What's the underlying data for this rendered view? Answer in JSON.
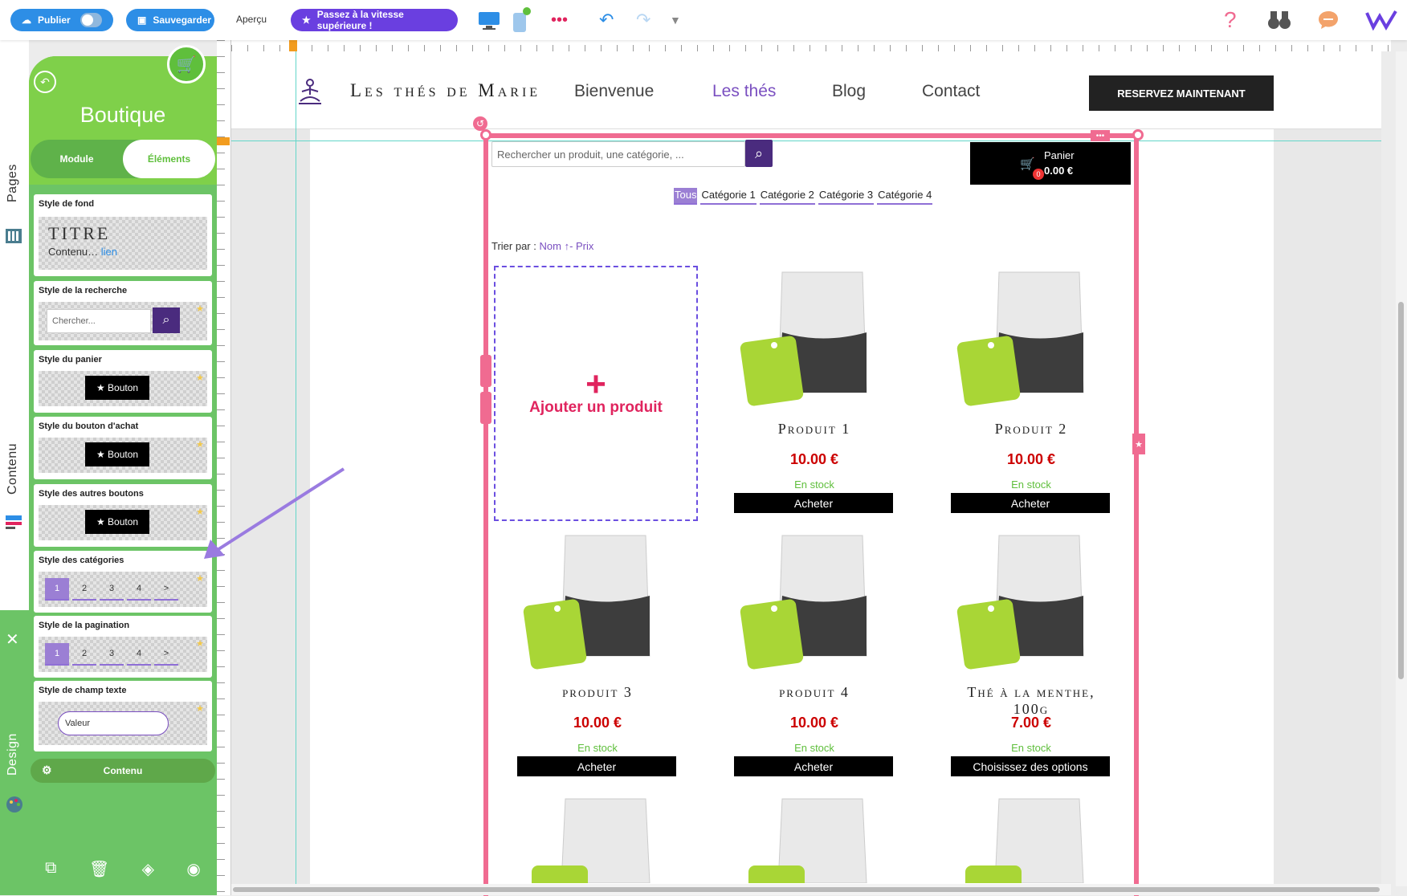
{
  "toolbar": {
    "publish_label": "Publier",
    "save_label": "Sauvegarder",
    "preview_label": "Aperçu",
    "upgrade_label": "Passez à la vitesse supérieure !",
    "help_icon": "?"
  },
  "rail": {
    "pages_label": "Pages",
    "content_label": "Contenu",
    "design_label": "Design"
  },
  "panel": {
    "title": "Boutique",
    "tabs": [
      "Module",
      "Éléments"
    ],
    "cards": [
      {
        "title": "Style de fond",
        "sample_title": "TITRE",
        "sample_text": "Contenu…",
        "sample_link": "lien"
      },
      {
        "title": "Style de la recherche",
        "placeholder": "Chercher..."
      },
      {
        "title": "Style du panier",
        "button": "★ Bouton"
      },
      {
        "title": "Style du bouton d'achat",
        "button": "★ Bouton"
      },
      {
        "title": "Style des autres boutons",
        "button": "★ Bouton"
      },
      {
        "title": "Style des catégories",
        "pages": [
          "1",
          "2",
          "3",
          "4",
          ">"
        ]
      },
      {
        "title": "Style de la pagination",
        "pages": [
          "1",
          "2",
          "3",
          "4",
          ">"
        ]
      },
      {
        "title": "Style de champ texte",
        "value": "Valeur"
      }
    ],
    "footer_label": "Contenu"
  },
  "site": {
    "name": "Les thés de Marie",
    "nav": [
      "Bienvenue",
      "Les thés",
      "Blog",
      "Contact"
    ],
    "active_nav": "Les thés",
    "cta": "RESERVEZ MAINTENANT"
  },
  "shop": {
    "search_placeholder": "Rechercher un produit, une catégorie, ...",
    "cart_title": "Panier",
    "cart_total": "0.00 €",
    "cart_count": "0",
    "categories": [
      "Tous",
      "Catégorie 1",
      "Catégorie 2",
      "Catégorie 3",
      "Catégorie 4"
    ],
    "sort_label": "Trier par :",
    "sort_name": "Nom",
    "sort_price": "↑- Prix",
    "add_product": "Ajouter un produit",
    "products": [
      {
        "name": "Produit 1",
        "price": "10.00 €",
        "stock": "En stock",
        "button": "Acheter"
      },
      {
        "name": "Produit 2",
        "price": "10.00 €",
        "stock": "En stock",
        "button": "Acheter"
      },
      {
        "name": "produit 3",
        "price": "10.00 €",
        "stock": "En stock",
        "button": "Acheter"
      },
      {
        "name": "produit 4",
        "price": "10.00 €",
        "stock": "En stock",
        "button": "Acheter"
      },
      {
        "name": "Thé à la menthe, 100g",
        "price": "7.00 €",
        "stock": "En stock",
        "button": "Choisissez des options"
      }
    ]
  },
  "colors": {
    "primary_blue": "#2d8ee6",
    "upgrade_purple": "#6a3fe0",
    "panel_green": "#6cc466",
    "frame_pink": "#f06b91",
    "accent_purple": "#7a4fc0",
    "price_red": "#c00"
  }
}
